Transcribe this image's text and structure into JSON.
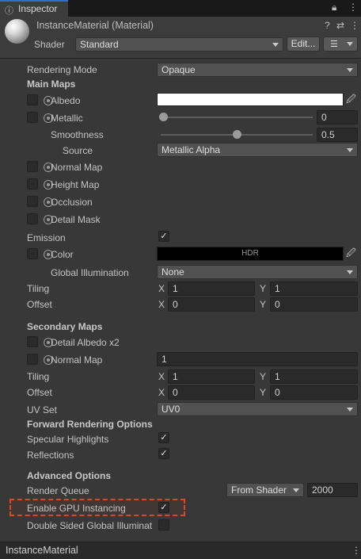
{
  "window": {
    "tab_label": "Inspector",
    "tab_icon": "info-icon",
    "lock_icon": "lock-icon",
    "menu_icon": "kebab-menu-icon"
  },
  "header": {
    "title": "InstanceMaterial (Material)",
    "shader_label": "Shader",
    "shader_value": "Standard",
    "edit_label": "Edit...",
    "icons": [
      "help-icon",
      "preset-icon",
      "kebab-menu-icon"
    ]
  },
  "rendering_mode": {
    "label": "Rendering Mode",
    "value": "Opaque"
  },
  "main_maps": {
    "heading": "Main Maps",
    "albedo": {
      "label": "Albedo",
      "color": "#ffffff"
    },
    "metallic": {
      "label": "Metallic",
      "value": "0",
      "fraction": 0.0
    },
    "smoothness": {
      "label": "Smoothness",
      "value": "0.5",
      "fraction": 0.5
    },
    "source": {
      "label": "Source",
      "value": "Metallic Alpha"
    },
    "normal_map": {
      "label": "Normal Map"
    },
    "height_map": {
      "label": "Height Map"
    },
    "occlusion": {
      "label": "Occlusion"
    },
    "detail_mask": {
      "label": "Detail Mask"
    },
    "emission": {
      "label": "Emission",
      "checked": true
    },
    "color": {
      "label": "Color",
      "swatch_text": "HDR",
      "color": "#000000"
    },
    "global_illumination": {
      "label": "Global Illumination",
      "value": "None"
    },
    "tiling": {
      "label": "Tiling",
      "x_label": "X",
      "x": "1",
      "y_label": "Y",
      "y": "1"
    },
    "offset": {
      "label": "Offset",
      "x_label": "X",
      "x": "0",
      "y_label": "Y",
      "y": "0"
    }
  },
  "secondary_maps": {
    "heading": "Secondary Maps",
    "detail_albedo": {
      "label": "Detail Albedo x2"
    },
    "normal_map": {
      "label": "Normal Map",
      "value": "1"
    },
    "tiling": {
      "label": "Tiling",
      "x_label": "X",
      "x": "1",
      "y_label": "Y",
      "y": "1"
    },
    "offset": {
      "label": "Offset",
      "x_label": "X",
      "x": "0",
      "y_label": "Y",
      "y": "0"
    },
    "uv_set": {
      "label": "UV Set",
      "value": "UV0"
    }
  },
  "forward_rendering": {
    "heading": "Forward Rendering Options",
    "specular": {
      "label": "Specular Highlights",
      "checked": true
    },
    "reflections": {
      "label": "Reflections",
      "checked": true
    }
  },
  "advanced": {
    "heading": "Advanced Options",
    "render_queue": {
      "label": "Render Queue",
      "mode": "From Shader",
      "value": "2000"
    },
    "gpu_instancing": {
      "label": "Enable GPU Instancing",
      "checked": true
    },
    "double_sided_gi": {
      "label": "Double Sided Global Illuminat",
      "checked": false
    }
  },
  "footer": {
    "label": "InstanceMaterial"
  },
  "checkmark": "✓",
  "colors": {
    "highlight": "#e0461f",
    "accent": "#2f6fd0"
  }
}
